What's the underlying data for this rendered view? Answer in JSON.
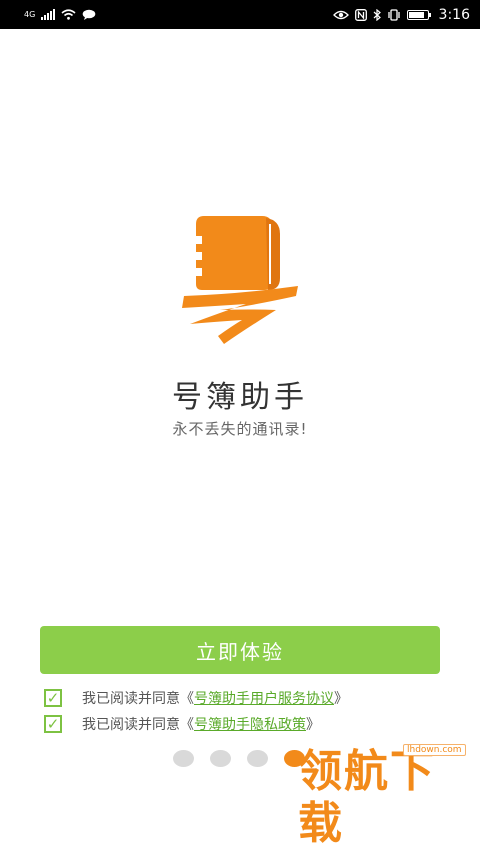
{
  "status_bar": {
    "network_type": "4G",
    "time": "3:16",
    "battery_level": 0.85
  },
  "app": {
    "title": "号簿助手",
    "slogan": "永不丢失的通讯录!",
    "logo_icon": "orange-notebook-logo",
    "accent_color": "#f28a1a"
  },
  "main": {
    "start_button_label": "立即体验",
    "button_color": "#8cce4a"
  },
  "agreements": [
    {
      "prefix": "我已阅读并同意《",
      "link": "号簿助手用户服务协议",
      "suffix": "》",
      "checked": true
    },
    {
      "prefix": "我已阅读并同意《",
      "link": "号簿助手隐私政策",
      "suffix": "》",
      "checked": true
    }
  ],
  "pager": {
    "total": 4,
    "current": 4
  },
  "watermark": {
    "site": "lhdown.com",
    "text": "领航下载"
  }
}
